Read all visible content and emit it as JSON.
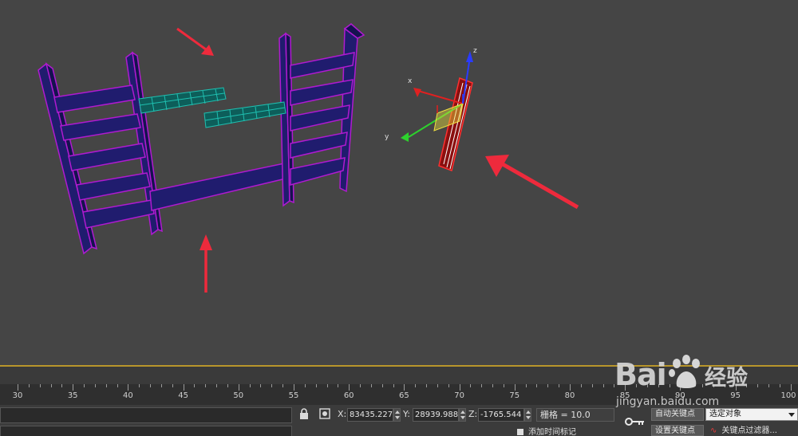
{
  "ruler": {
    "ticks": [
      "30",
      "35",
      "40",
      "45",
      "50",
      "55",
      "60",
      "65",
      "70",
      "75",
      "80",
      "85",
      "90",
      "95",
      "100"
    ]
  },
  "status": {
    "lock_icon": "lock-icon",
    "selection_mode_icon": "absolute-mode-icon",
    "x_label": "X:",
    "x_value": "83435.227",
    "y_label": "Y:",
    "y_value": "28939.988",
    "z_label": "Z:",
    "z_value": "-1765.544",
    "grid_label": "栅格 = 10.0",
    "add_time_tag": "添加时间标记",
    "auto_key": "自动关键点",
    "set_key": "设置关键点",
    "selection_set": "选定对象",
    "key_filters": "关键点过滤器...",
    "key_icon": "key-icon"
  },
  "gizmo": {
    "z_label": "z",
    "y_label": "y",
    "x_label": "x"
  },
  "watermark": {
    "brand": "Bai",
    "product": "经验",
    "url": "jingyan.baidu.com"
  },
  "colors": {
    "accent_timeline": "#b8952b",
    "shelf_fill": "#1f1b6e",
    "shelf_edge": "#b01ad0",
    "teal_mesh": "#1fbfb0",
    "arrow_red": "#ee2a3c",
    "selected_red": "#e02020"
  }
}
